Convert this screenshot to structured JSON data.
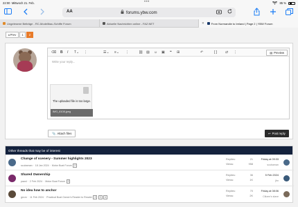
{
  "status": {
    "time": "22:00",
    "date": "Mittwoch 21. Feb.",
    "battery": "85 %"
  },
  "browser": {
    "text_size_label": "AA",
    "url": "forums.ybw.com",
    "tabs": [
      {
        "title": "Ungelesene Beiträge - RC-Modellbau-Schiffe Forum",
        "fav_color": "#e08a2a"
      },
      {
        "title": "Aktuelle Nachrichten online - FAZ.NET",
        "fav_color": "#555555"
      },
      {
        "title": "From Normandie to Ireland | Page 2 | YBW Forum",
        "fav_color": "#1a3a6a"
      }
    ]
  },
  "pager": {
    "prev": "◂ Prev",
    "pages": [
      "1",
      "2"
    ]
  },
  "editor": {
    "placeholder": "Write your reply...",
    "preview_label": "Preview",
    "attachment": {
      "message": "The uploaded file is too large.",
      "filename": "IMG_6108.jpeg"
    },
    "attach_label": "Attach files",
    "post_label": "Post reply"
  },
  "threads": {
    "header": "Other threads that may be of interest",
    "replies_label": "Replies:",
    "views_label": "Views:",
    "rows": [
      {
        "title": "Change of scenery - Summer highlights 2023",
        "author": "scubaman",
        "date": "18 Jan 2024",
        "forum": "Motor Boat Forum",
        "pages": [
          "2"
        ],
        "replies": "21",
        "views": "958",
        "last_date": "Friday at 09:33",
        "last_user": "scubaman",
        "avatar_color": "#4a6a8a",
        "avatar2_color": "#4a6a8a"
      },
      {
        "title": "Shared Ownership",
        "author": "pawd",
        "date": "2 Feb 2024",
        "forum": "Motor Boat Forum",
        "pages": [
          "2"
        ],
        "replies": "36",
        "views": "1K",
        "last_date": "5 Feb 2024",
        "last_user": "jfm",
        "avatar_color": "#7a2a6a",
        "avatar2_color": "#3a5a7a"
      },
      {
        "title": "No idea how to anchor",
        "author": "gecm",
        "date": "11 Feb 2024",
        "forum": "Practical Boat Owner's Reader to Reader",
        "pages": [
          "2",
          "3",
          "4"
        ],
        "replies": "70",
        "views": "2K",
        "last_date": "Friday at 08:06",
        "last_user": "Citizen's slave",
        "avatar_color": "#5a4a3a",
        "avatar2_color": "#7a6a5a"
      }
    ]
  }
}
